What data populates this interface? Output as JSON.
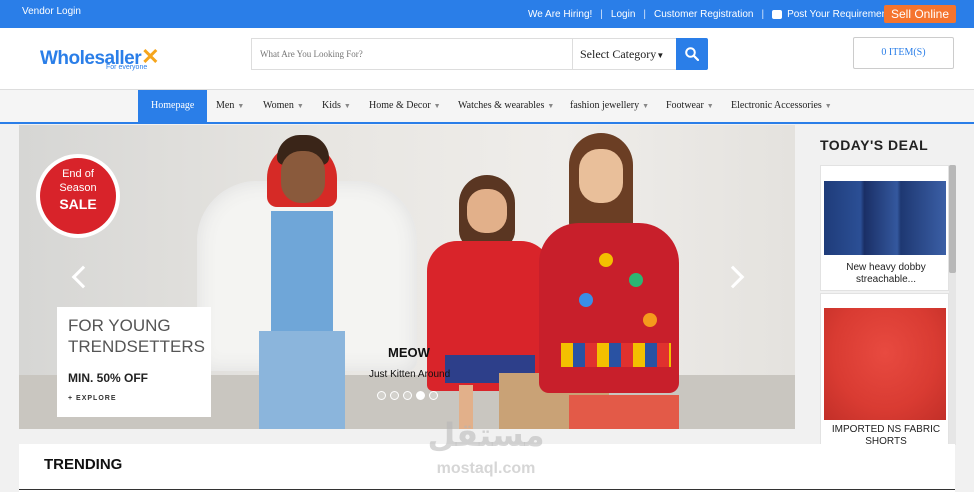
{
  "topbar": {
    "vendor_login": "Vendor Login",
    "links": [
      "We Are Hiring!",
      "Login",
      "Customer Registration",
      "Post Your Requirement"
    ],
    "sell_online": "Sell Online"
  },
  "header": {
    "logo_text": "Wholesaller",
    "logo_tagline": "For everyone",
    "search_placeholder": "What Are You Looking For?",
    "category_label": "Select Category",
    "cart_label": "0 ITEM(S)"
  },
  "nav": {
    "items": [
      "Homepage",
      "Men",
      "Women",
      "Kids",
      "Home & Decor",
      "Watches & wearables",
      "fashion jewellery",
      "Footwear",
      "Electronic Accessories"
    ]
  },
  "banner": {
    "badge": [
      "End of",
      "Season",
      "SALE"
    ],
    "promo_line1": "FOR YOUNG",
    "promo_line2": "TRENDSETTERS",
    "promo_offer": "MIN. 50% OFF",
    "promo_cta": "+ EXPLORE",
    "caption_title": "MEOW",
    "caption_sub": "Just Kitten Around",
    "slide_count": 5,
    "active_slide": 4
  },
  "deal": {
    "title": "TODAY'S DEAL",
    "items": [
      {
        "label_1": "New heavy dobby",
        "label_2": "streachable..."
      },
      {
        "label_1": "IMPORTED NS FABRIC",
        "label_2": "SHORTS"
      }
    ]
  },
  "trending": {
    "title": "TRENDING"
  },
  "watermark": {
    "arabic": "مستقل",
    "latin": "mostaql.com"
  },
  "colors": {
    "primary": "#2a7ee8",
    "accent": "#f5742e",
    "sale_red": "#d8232a"
  }
}
